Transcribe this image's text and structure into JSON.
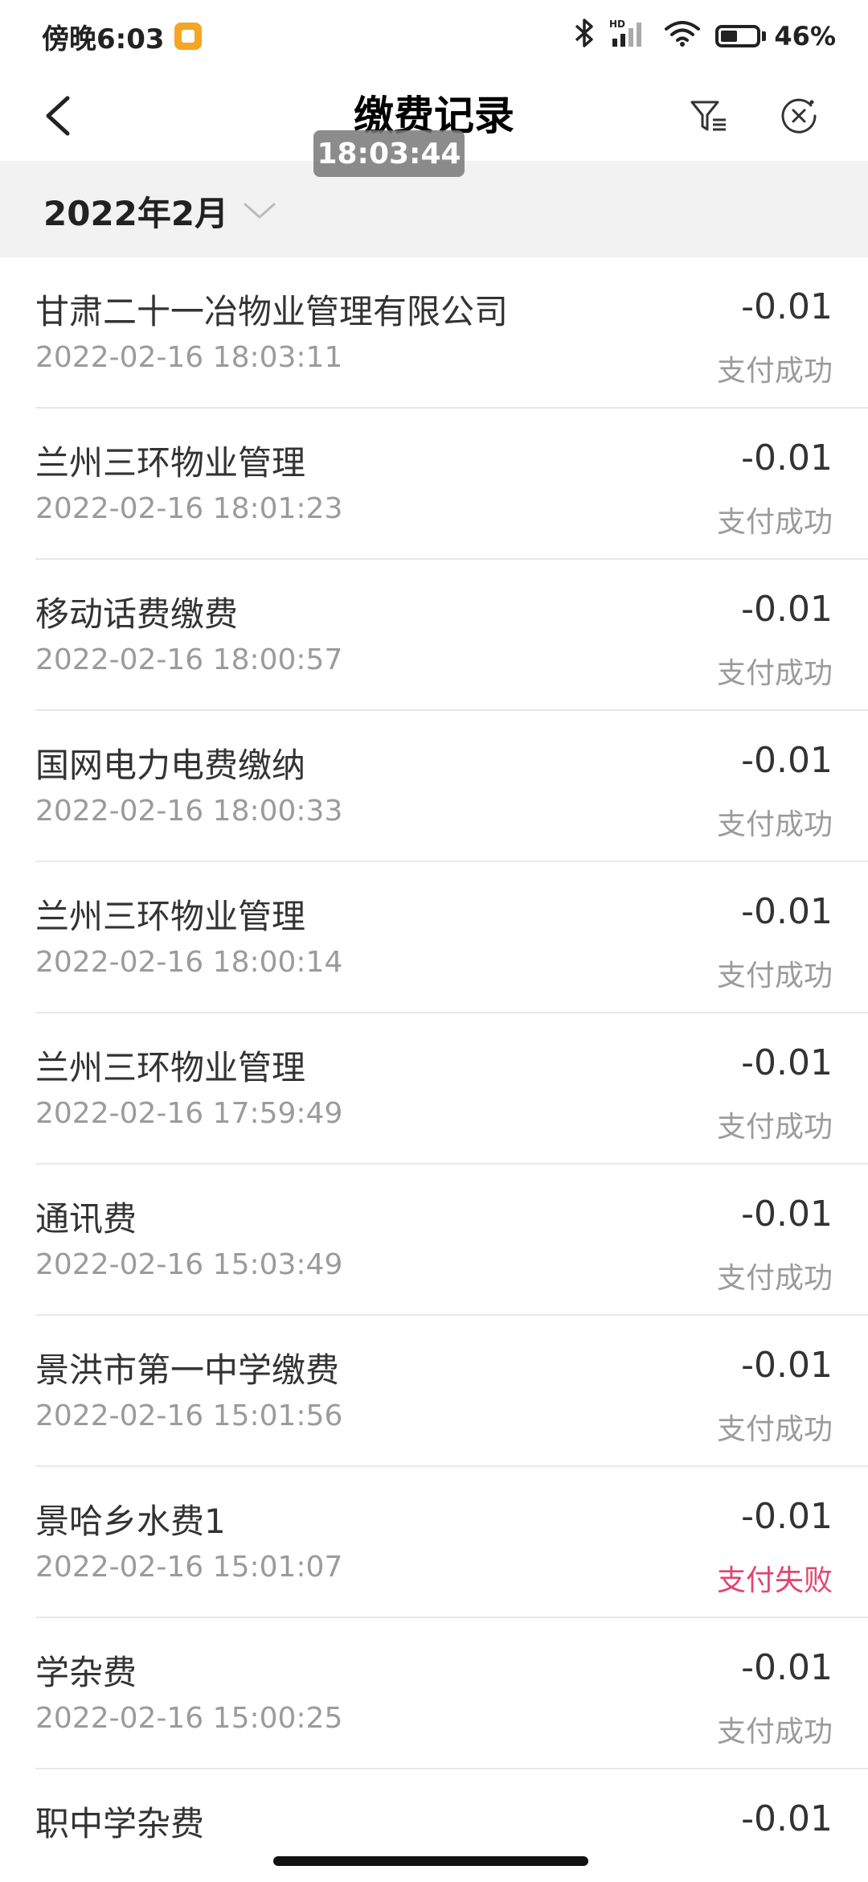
{
  "status_bar": {
    "time": "傍晚6:03",
    "battery_pct": "46%",
    "battery_level": 0.46,
    "icons": [
      "bluetooth-icon",
      "hd-signal-icon",
      "wifi-icon",
      "battery-icon"
    ]
  },
  "header": {
    "title": "缴费记录",
    "icons": [
      "back-chevron-icon",
      "filter-icon",
      "close-circle-icon"
    ]
  },
  "overlay_time": "18:03:44",
  "month": {
    "label": "2022年2月",
    "icon": "chevron-down-icon"
  },
  "colors": {
    "failed": "#e0466f",
    "muted": "#9b9b9b",
    "section_bg": "#f2f2f2"
  },
  "records": [
    {
      "name": "甘肃二十一冶物业管理有限公司",
      "time": "2022-02-16 18:03:11",
      "amount": "-0.01",
      "status": "支付成功",
      "failed": false
    },
    {
      "name": "兰州三环物业管理",
      "time": "2022-02-16 18:01:23",
      "amount": "-0.01",
      "status": "支付成功",
      "failed": false
    },
    {
      "name": "移动话费缴费",
      "time": "2022-02-16 18:00:57",
      "amount": "-0.01",
      "status": "支付成功",
      "failed": false
    },
    {
      "name": "国网电力电费缴纳",
      "time": "2022-02-16 18:00:33",
      "amount": "-0.01",
      "status": "支付成功",
      "failed": false
    },
    {
      "name": "兰州三环物业管理",
      "time": "2022-02-16 18:00:14",
      "amount": "-0.01",
      "status": "支付成功",
      "failed": false
    },
    {
      "name": "兰州三环物业管理",
      "time": "2022-02-16 17:59:49",
      "amount": "-0.01",
      "status": "支付成功",
      "failed": false
    },
    {
      "name": "通讯费",
      "time": "2022-02-16 15:03:49",
      "amount": "-0.01",
      "status": "支付成功",
      "failed": false
    },
    {
      "name": "景洪市第一中学缴费",
      "time": "2022-02-16 15:01:56",
      "amount": "-0.01",
      "status": "支付成功",
      "failed": false
    },
    {
      "name": "景哈乡水费1",
      "time": "2022-02-16 15:01:07",
      "amount": "-0.01",
      "status": "支付失败",
      "failed": true
    },
    {
      "name": "学杂费",
      "time": "2022-02-16 15:00:25",
      "amount": "-0.01",
      "status": "支付成功",
      "failed": false
    },
    {
      "name": "职中学杂费",
      "time": "",
      "amount": "-0.01",
      "status": "",
      "failed": false
    }
  ]
}
